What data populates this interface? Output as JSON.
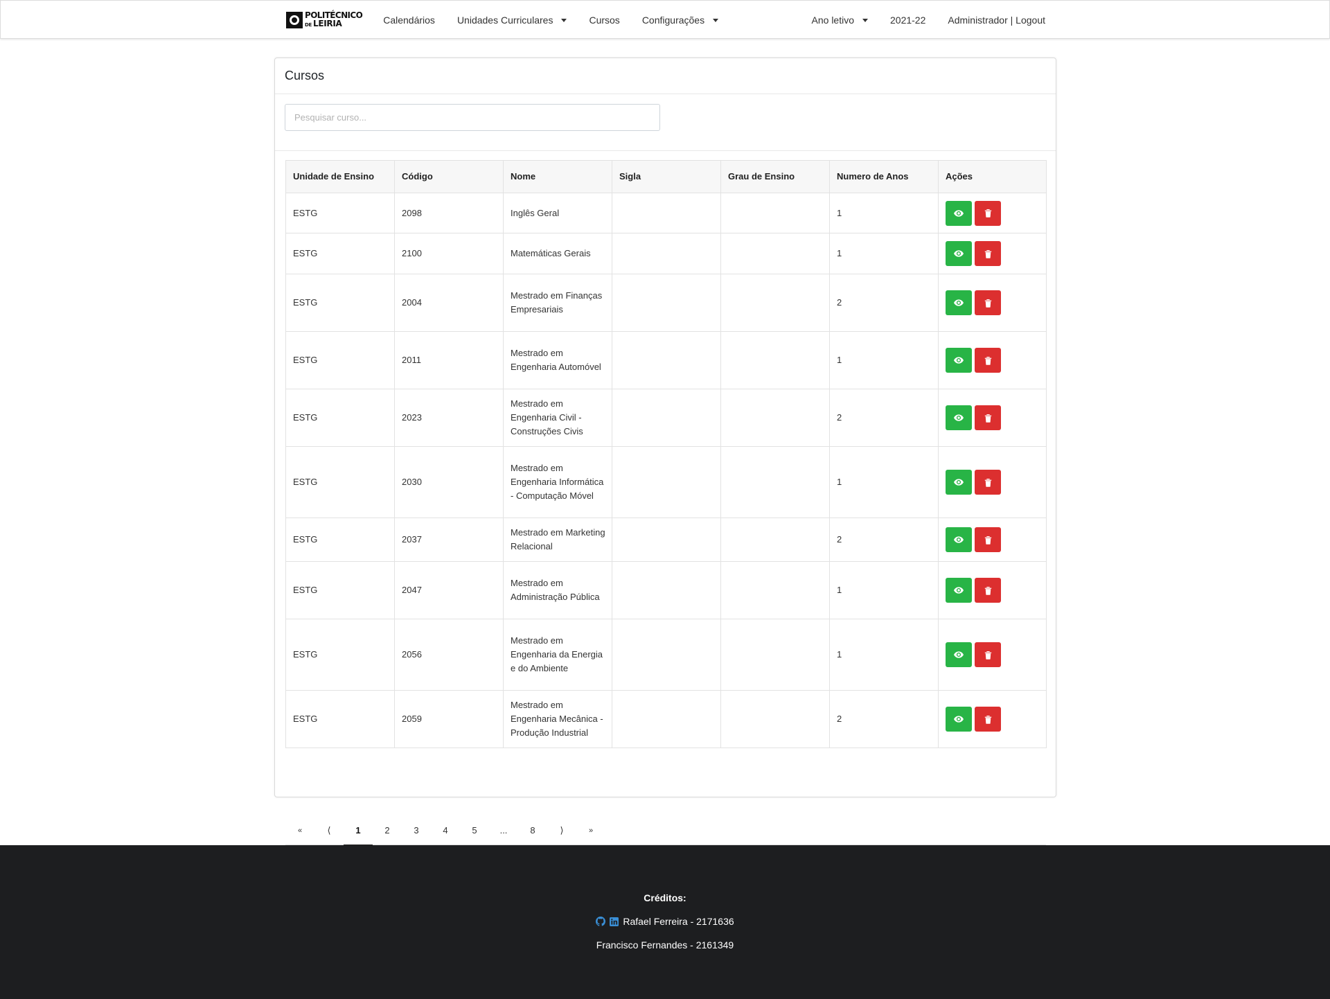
{
  "navbar": {
    "logo_line1": "POLITÉCNICO",
    "logo_line2_prefix": "DE",
    "logo_line2": "LEIRIA",
    "links": {
      "calendarios": "Calendários",
      "unidades": "Unidades Curriculares",
      "cursos": "Cursos",
      "configuracoes": "Configurações"
    },
    "ano_letivo": "Ano letivo",
    "ano": "2021-22",
    "user": "Administrador | Logout"
  },
  "card": {
    "title": "Cursos",
    "search_placeholder": "Pesquisar curso..."
  },
  "table": {
    "headers": {
      "unidade": "Unidade de Ensino",
      "codigo": "Código",
      "nome": "Nome",
      "sigla": "Sigla",
      "grau": "Grau de Ensino",
      "anos": "Numero de Anos",
      "acoes": "Ações"
    },
    "rows": [
      {
        "unidade": "ESTG",
        "codigo": "2098",
        "nome": "Inglês Geral",
        "sigla": "",
        "grau": "",
        "anos": "1"
      },
      {
        "unidade": "ESTG",
        "codigo": "2100",
        "nome": "Matemáticas Gerais",
        "sigla": "",
        "grau": "",
        "anos": "1"
      },
      {
        "unidade": "ESTG",
        "codigo": "2004",
        "nome": "Mestrado em Finanças Empresariais",
        "sigla": "",
        "grau": "",
        "anos": "2"
      },
      {
        "unidade": "ESTG",
        "codigo": "2011",
        "nome": "Mestrado em Engenharia Automóvel",
        "sigla": "",
        "grau": "",
        "anos": "1"
      },
      {
        "unidade": "ESTG",
        "codigo": "2023",
        "nome": "Mestrado em Engenharia Civil - Construções Civis",
        "sigla": "",
        "grau": "",
        "anos": "2"
      },
      {
        "unidade": "ESTG",
        "codigo": "2030",
        "nome": "Mestrado em Engenharia Informática - Computação Móvel",
        "sigla": "",
        "grau": "",
        "anos": "1"
      },
      {
        "unidade": "ESTG",
        "codigo": "2037",
        "nome": "Mestrado em Marketing Relacional",
        "sigla": "",
        "grau": "",
        "anos": "2"
      },
      {
        "unidade": "ESTG",
        "codigo": "2047",
        "nome": "Mestrado em Administração Pública",
        "sigla": "",
        "grau": "",
        "anos": "1"
      },
      {
        "unidade": "ESTG",
        "codigo": "2056",
        "nome": "Mestrado em Engenharia da Energia e do Ambiente",
        "sigla": "",
        "grau": "",
        "anos": "1"
      },
      {
        "unidade": "ESTG",
        "codigo": "2059",
        "nome": "Mestrado em Engenharia Mecânica - Produção Industrial",
        "sigla": "",
        "grau": "",
        "anos": "2"
      }
    ],
    "action_icons": {
      "view": "eye-icon",
      "delete": "trash-icon"
    }
  },
  "pagination": {
    "first": "«",
    "prev": "⟨",
    "pages": [
      "1",
      "2",
      "3",
      "4",
      "5",
      "...",
      "8"
    ],
    "active_page": "1",
    "next": "⟩",
    "last": "»"
  },
  "footer": {
    "title": "Créditos:",
    "credit1": "Rafael Ferreira - 2171636",
    "credit2": "Francisco Fernandes - 2161349",
    "icons": [
      "github-icon",
      "linkedin-icon"
    ]
  },
  "colors": {
    "view_button": "#28b446",
    "delete_button": "#dc2f2f",
    "footer_bg": "#1d1e20",
    "icon_blue": "#3a8fd6"
  }
}
